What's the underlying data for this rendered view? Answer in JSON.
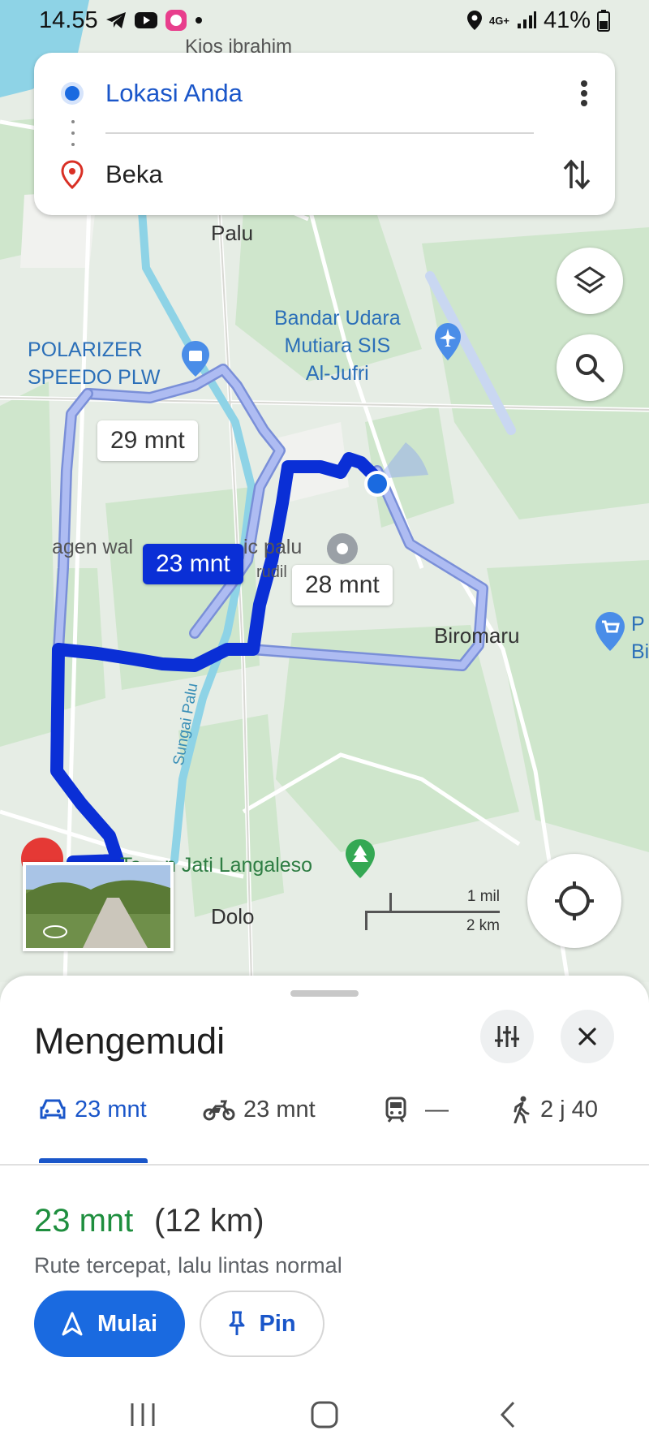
{
  "status_bar": {
    "time": "14.55",
    "battery": "41%",
    "network": "4G+"
  },
  "directions": {
    "origin": "Lokasi Anda",
    "destination": "Beka"
  },
  "map": {
    "labels": {
      "top_poi": "Kios ibrahim",
      "palu": "Palu",
      "airport": "Bandar Udara\nMutiara SIS\nAl-Jufri",
      "polarizer": "POLARIZER\nSPEEDO PLW",
      "agen": "agen wal",
      "agen2": "ic palu",
      "rudil": "rudil",
      "biromaru": "Biromaru",
      "river": "Sungai Palu",
      "taman_start": "Ta",
      "taman": "n Jati Langaleso",
      "dolo": "Dolo",
      "edge_right": "P\nBi"
    },
    "routes": [
      {
        "label": "29 mnt",
        "selected": false
      },
      {
        "label": "23 mnt",
        "selected": true
      },
      {
        "label": "28 mnt",
        "selected": false
      }
    ],
    "scale": {
      "imperial": "1 mil",
      "metric": "2 km"
    }
  },
  "sheet": {
    "title": "Mengemudi",
    "modes": [
      {
        "icon": "car-icon",
        "label": "23 mnt",
        "active": true
      },
      {
        "icon": "motorcycle-icon",
        "label": "23 mnt",
        "active": false
      },
      {
        "icon": "transit-icon",
        "label": "—",
        "active": false
      },
      {
        "icon": "walk-icon",
        "label": "2 j 40",
        "active": false
      }
    ],
    "summary": {
      "time": "23 mnt",
      "distance": "(12 km)",
      "description": "Rute tercepat, lalu lintas normal"
    },
    "start_label": "Mulai",
    "pin_label": "Pin"
  },
  "colors": {
    "route_selected": "#0a2fd6",
    "route_alt": "#a9b8f2",
    "accent": "#1a6ae0",
    "green_text": "#1e8e3e"
  }
}
